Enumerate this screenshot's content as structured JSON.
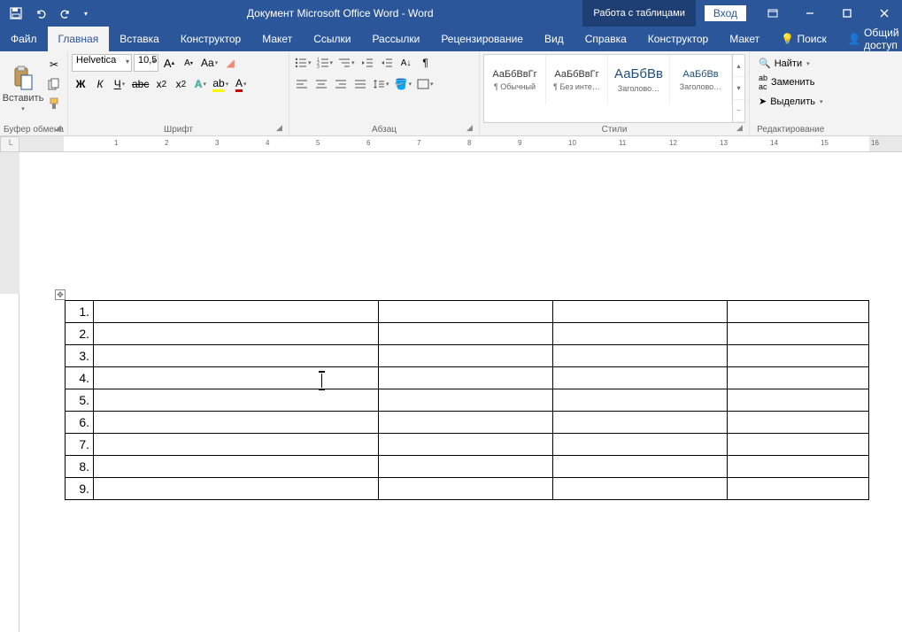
{
  "title": "Документ Microsoft Office Word - Word",
  "tabletools_label": "Работа с таблицами",
  "login_label": "Вход",
  "tabs": {
    "file": "Файл",
    "home": "Главная",
    "insert": "Вставка",
    "design": "Конструктор",
    "layout": "Макет",
    "references": "Ссылки",
    "mailings": "Рассылки",
    "review": "Рецензирование",
    "view": "Вид",
    "help": "Справка",
    "table_design": "Конструктор",
    "table_layout": "Макет",
    "search": "Поиск",
    "share": "Общий доступ"
  },
  "ribbon": {
    "clipboard": {
      "label": "Буфер обмена",
      "paste": "Вставить"
    },
    "font": {
      "label": "Шрифт",
      "name": "Helvetica",
      "size": "10,5"
    },
    "paragraph": {
      "label": "Абзац"
    },
    "styles": {
      "label": "Стили",
      "preview": "АаБбВвГг",
      "preview_big": "АаБбВв",
      "items": [
        "¶ Обычный",
        "¶ Без инте…",
        "Заголово…",
        "Заголово…"
      ]
    },
    "editing": {
      "label": "Редактирование",
      "find": "Найти",
      "replace": "Заменить",
      "select": "Выделить"
    }
  },
  "table_rows": [
    "1.",
    "2.",
    "3.",
    "4.",
    "5.",
    "6.",
    "7.",
    "8.",
    "9."
  ]
}
